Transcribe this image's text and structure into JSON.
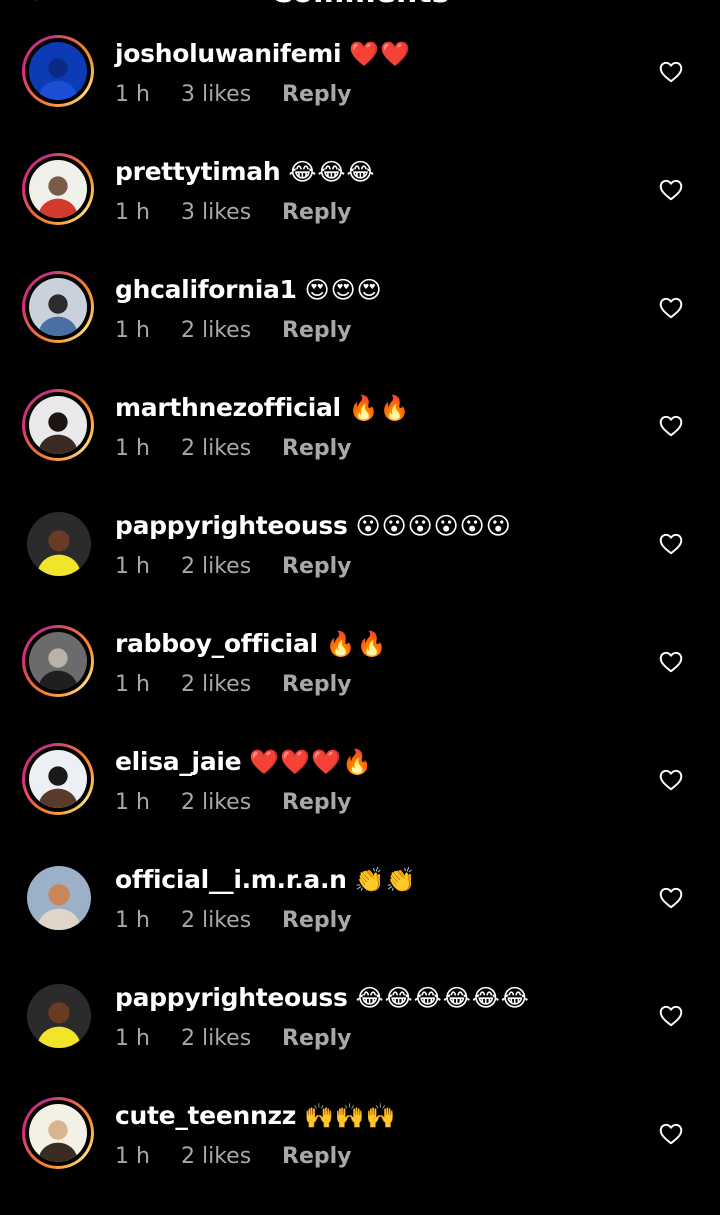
{
  "header": {
    "title": "Comments",
    "back_glyph": "←"
  },
  "comments": [
    {
      "username": "josholuwanifemi",
      "emojis": "❤️❤️",
      "time": "1 h",
      "likes": "3 likes",
      "reply_label": "Reply",
      "avatar_palette": [
        "#0d3bb5",
        "#1a4fd6",
        "#0a2a86"
      ],
      "has_story": true
    },
    {
      "username": "prettytimah",
      "emojis": "😂😂😂",
      "time": "1 h",
      "likes": "3 likes",
      "reply_label": "Reply",
      "avatar_palette": [
        "#f1efe9",
        "#d23a2e",
        "#7a5b49"
      ],
      "has_story": true
    },
    {
      "username": "ghcalifornia1",
      "emojis": "😍😍😍",
      "time": "1 h",
      "likes": "2 likes",
      "reply_label": "Reply",
      "avatar_palette": [
        "#c9d2db",
        "#4a6fa5",
        "#2b2b2b"
      ],
      "has_story": true
    },
    {
      "username": "marthnezofficial",
      "emojis": "🔥🔥",
      "time": "1 h",
      "likes": "2 likes",
      "reply_label": "Reply",
      "avatar_palette": [
        "#e9e9ec",
        "#3a2a22",
        "#1b1412"
      ],
      "has_story": true
    },
    {
      "username": "pappyrighteouss",
      "emojis": "😮😮😮😮😮😮",
      "time": "1 h",
      "likes": "2 likes",
      "reply_label": "Reply",
      "avatar_palette": [
        "#2b2b2b",
        "#f2e32b",
        "#6b3a22"
      ],
      "has_story": false
    },
    {
      "username": "rabboy_official",
      "emojis": "🔥🔥",
      "time": "1 h",
      "likes": "2 likes",
      "reply_label": "Reply",
      "avatar_palette": [
        "#6b6b6b",
        "#1f1f1f",
        "#b9b2a6"
      ],
      "has_story": true
    },
    {
      "username": "elisa_jaie",
      "emojis": "❤️❤️❤️🔥",
      "time": "1 h",
      "likes": "2 likes",
      "reply_label": "Reply",
      "avatar_palette": [
        "#eceff4",
        "#5a3a2b",
        "#1a1a1a"
      ],
      "has_story": true
    },
    {
      "username": "official__i.m.r.a.n",
      "emojis": "👏👏",
      "time": "1 h",
      "likes": "2 likes",
      "reply_label": "Reply",
      "avatar_palette": [
        "#9cb0c8",
        "#e0d6c8",
        "#c9865a"
      ],
      "has_story": false
    },
    {
      "username": "pappyrighteouss",
      "emojis": "😂😂😂😂😂😂",
      "time": "1 h",
      "likes": "2 likes",
      "reply_label": "Reply",
      "avatar_palette": [
        "#2b2b2b",
        "#f2e32b",
        "#6b3a22"
      ],
      "has_story": false
    },
    {
      "username": "cute_teennzz",
      "emojis": "🙌🙌🙌",
      "time": "1 h",
      "likes": "2 likes",
      "reply_label": "Reply",
      "avatar_palette": [
        "#f3f0e6",
        "#3a2c22",
        "#d9b48f"
      ],
      "has_story": true
    }
  ],
  "colors": {
    "background": "#000000",
    "primary_text": "#ffffff",
    "secondary_text": "#a8a8a8",
    "story_ring_start": "#f58529",
    "story_ring_end": "#dd2a7b"
  },
  "icons": {
    "like": "heart-outline-icon",
    "back": "arrow-left-icon",
    "share": "paper-plane-icon"
  }
}
